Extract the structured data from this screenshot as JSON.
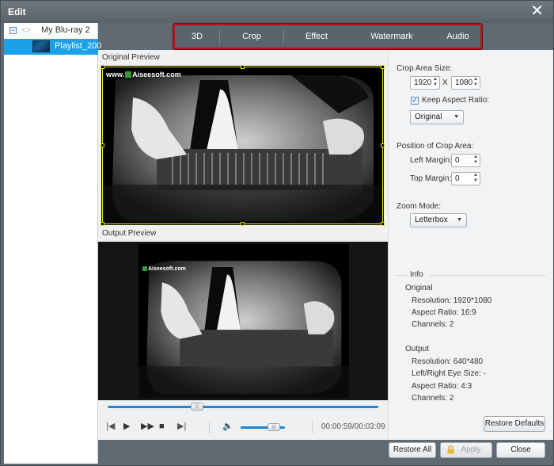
{
  "window": {
    "title": "Edit"
  },
  "tree": {
    "disc_label": "My Blu-ray 2",
    "playlist_label": "Playlist_200"
  },
  "tabs": [
    "3D",
    "Crop",
    "Effect",
    "Watermark",
    "Audio"
  ],
  "preview": {
    "original_label": "Original Preview",
    "output_label": "Output Preview",
    "watermark_prefix": "www.",
    "watermark_brand": "Aiseesoft.com",
    "out_watermark_brand": "Aiseesoft.com"
  },
  "player": {
    "time": "00:00:59/00:03:09",
    "progress_fraction": 0.33,
    "volume_fraction": 0.75,
    "knob_glyph": "|||"
  },
  "crop": {
    "area_size_label": "Crop Area Size:",
    "width": "1920",
    "x_label": "X",
    "height": "1080",
    "keep_aspect_label": "Keep Aspect Ratio:",
    "keep_aspect_checked": true,
    "aspect_option": "Original",
    "position_label": "Position of Crop Area:",
    "left_margin_label": "Left Margin:",
    "left_margin": "0",
    "top_margin_label": "Top Margin:",
    "top_margin": "0",
    "zoom_label": "Zoom Mode:",
    "zoom_option": "Letterbox"
  },
  "info": {
    "header": "Info",
    "original_header": "Original",
    "orig_resolution": "Resolution: 1920*1080",
    "orig_aspect": "Aspect Ratio: 16:9",
    "orig_channels": "Channels: 2",
    "output_header": "Output",
    "out_resolution": "Resolution: 640*480",
    "out_eye": "Left/Right Eye Size: -",
    "out_aspect": "Aspect Ratio: 4:3",
    "out_channels": "Channels: 2"
  },
  "buttons": {
    "restore_defaults": "Restore Defaults",
    "restore_all": "Restore All",
    "apply": "Apply",
    "close": "Close"
  },
  "colors": {
    "accent_blue": "#1aa1e8",
    "tab_highlight_border": "#b8121c",
    "crop_frame": "#e6e60f"
  }
}
